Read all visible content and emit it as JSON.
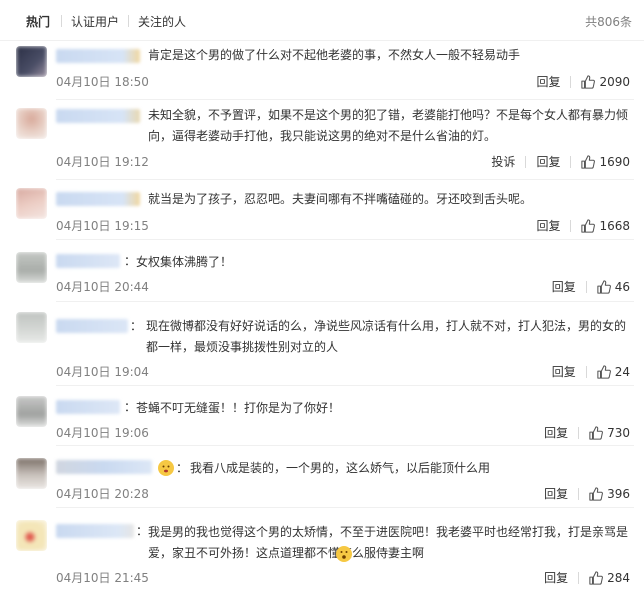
{
  "tabs": [
    "热门",
    "认证用户",
    "关注的人"
  ],
  "total": "共806条",
  "actions": {
    "reply": "回复",
    "report": "投诉"
  },
  "comments": [
    {
      "text": "肯定是这个男的做了什么对不起他老婆的事，不然女人一般不轻易动手",
      "time": "04月10日 18:50",
      "likes": "2090",
      "report": false
    },
    {
      "text": "未知全貌，不予置评，如果不是这个男的犯了错，老婆能打他吗？不是每个女人都有暴力倾向，逼得老婆动手打他，我只能说这男的绝对不是什么省油的灯。",
      "time": "04月10日 19:12",
      "likes": "1690",
      "report": true
    },
    {
      "text": "就当是为了孩子，忍忍吧。夫妻间哪有不拌嘴磕碰的。牙还咬到舌头呢。",
      "time": "04月10日 19:15",
      "likes": "1668",
      "report": false
    },
    {
      "text": "女权集体沸腾了！",
      "time": "04月10日 20:44",
      "likes": "46",
      "report": false
    },
    {
      "text": "现在微博都没有好好说话的么，净说些风凉话有什么用，打人就不对，打人犯法，男的女的都一样，最烦没事挑拨性别对立的人",
      "time": "04月10日 19:04",
      "likes": "24",
      "report": false
    },
    {
      "text": "苍蝇不叮无缝蛋！！打你是为了你好！",
      "time": "04月10日 19:06",
      "likes": "730",
      "report": false
    },
    {
      "text": "我看八成是装的，一个男的，这么娇气，以后能顶什么用",
      "time": "04月10日 20:28",
      "likes": "396",
      "report": false
    },
    {
      "text": "我是男的我也觉得这个男的太矫情，不至于进医院吧！我老婆平时也经常打我，打是亲骂是爱，家丑不可外扬！这点道理都不懂怎么服侍妻主啊",
      "time": "04月10日 21:45",
      "likes": "284",
      "report": false
    }
  ],
  "colors": {
    "muted": "#808080",
    "text": "#333333",
    "divider": "#f0f0f0"
  },
  "icons": {
    "like": "thumbs-up-icon",
    "emoji_worried": "worried-face-icon",
    "emoji_surprised": "surprised-face-icon"
  }
}
